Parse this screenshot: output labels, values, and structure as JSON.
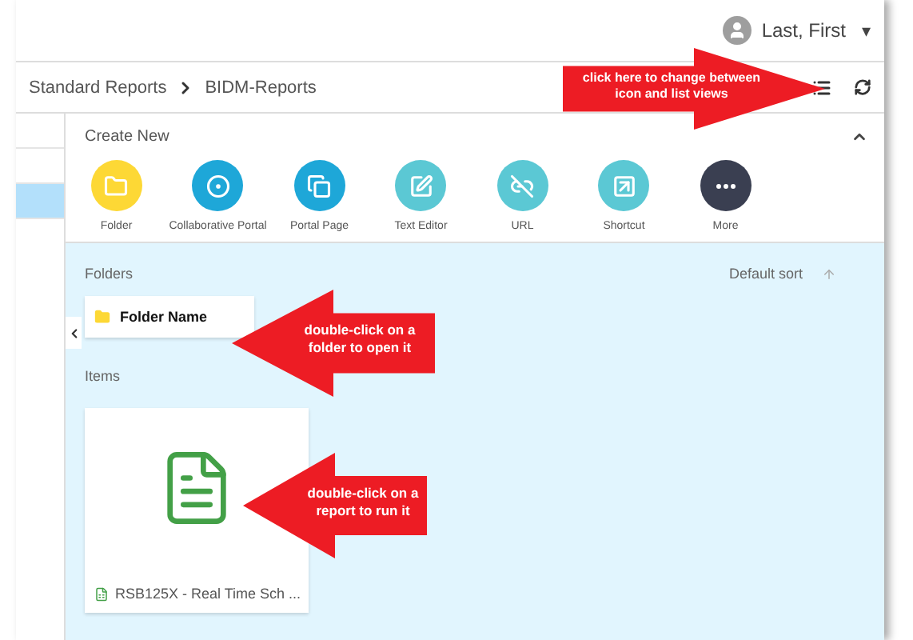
{
  "user_menu": {
    "name": "Last, First",
    "caret": "▾"
  },
  "breadcrumb": [
    {
      "label": "Standard Reports"
    },
    {
      "label": "BIDM-Reports"
    }
  ],
  "sidebar": {
    "items": [
      {
        "selected": false
      },
      {
        "selected": false
      },
      {
        "selected": true
      }
    ]
  },
  "create_new": {
    "title": "Create New",
    "expanded": true,
    "items": [
      {
        "label": "Folder",
        "color": "#fdd835"
      },
      {
        "label": "Collaborative Portal",
        "color": "#1ea7d8"
      },
      {
        "label": "Portal Page",
        "color": "#1ea7d8"
      },
      {
        "label": "Text Editor",
        "color": "#5bc8d4"
      },
      {
        "label": "URL",
        "color": "#5bc8d4"
      },
      {
        "label": "Shortcut",
        "color": "#5bc8d4"
      },
      {
        "label": "More",
        "color": "#3a3f51"
      }
    ]
  },
  "folders": {
    "title": "Folders",
    "sort": "Default sort",
    "items": [
      {
        "name": "Folder Name"
      }
    ]
  },
  "items": {
    "title": "Items",
    "items": [
      {
        "name": "RSB125X - Real Time Sch ..."
      }
    ]
  },
  "callouts": [
    {
      "kind": "right",
      "text": "click here to change between icon and list views"
    },
    {
      "kind": "left",
      "text": "double-click on a folder to open it"
    },
    {
      "kind": "left",
      "text": "double-click on a report to run it"
    }
  ]
}
